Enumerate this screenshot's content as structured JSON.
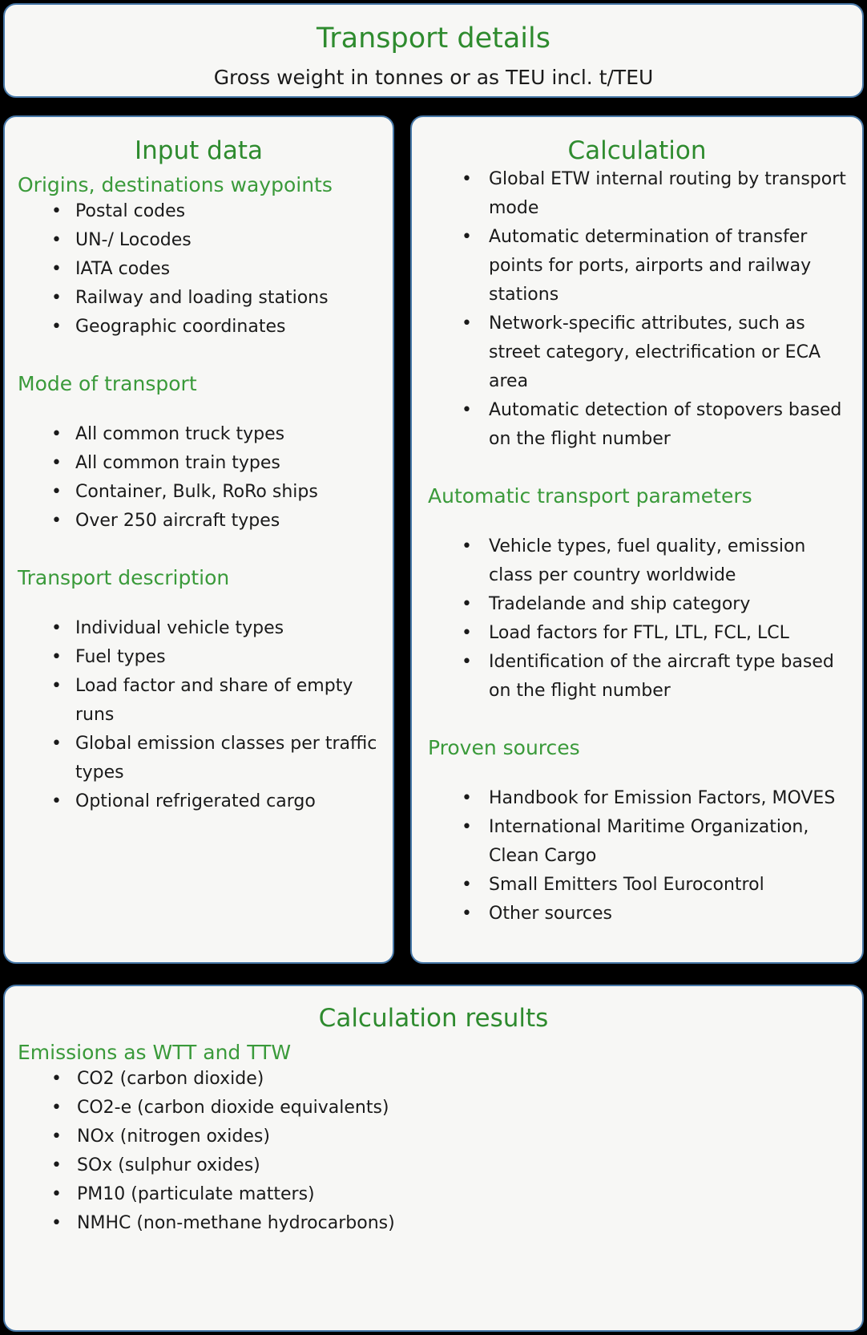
{
  "header": {
    "title": "Transport details",
    "subtitle": "Gross weight in tonnes or as TEU incl. t/TEU"
  },
  "input_card": {
    "title": "Input data",
    "sections": [
      {
        "heading": "Origins, destinations waypoints",
        "items": [
          "Postal codes",
          "UN-/ Locodes",
          "IATA codes",
          "Railway and loading stations",
          "Geographic coordinates"
        ]
      },
      {
        "heading": "Mode of transport",
        "items": [
          "All common truck types",
          "All common train types",
          "Container, Bulk, RoRo ships",
          "Over 250 aircraft types"
        ]
      },
      {
        "heading": "Transport description",
        "items": [
          "Individual vehicle types",
          "Fuel types",
          "Load factor and share of empty runs",
          "Global emission classes per traffic types",
          "Optional refrigerated cargo"
        ]
      }
    ]
  },
  "calculation_card": {
    "title": "Calculation",
    "intro_items": [
      "Global ETW internal routing by transport mode",
      "Automatic determination of transfer points for ports, airports and railway stations",
      "Network-specific attributes, such as street category, electrification or ECA area",
      "Automatic detection of stopovers based on the flight number"
    ],
    "sections": [
      {
        "heading": "Automatic transport parameters",
        "items": [
          "Vehicle types, fuel quality, emission class per country worldwide",
          "Tradelande and ship category",
          "Load factors for FTL, LTL, FCL, LCL",
          "Identification of the aircraft type based on the flight number"
        ]
      },
      {
        "heading": "Proven sources",
        "items": [
          "Handbook for Emission Factors, MOVES",
          "International Maritime Organization, Clean Cargo",
          "Small Emitters Tool Eurocontrol",
          "Other sources"
        ]
      }
    ]
  },
  "results_card": {
    "title": "Calculation results",
    "sections": [
      {
        "heading": "Emissions as WTT and TTW",
        "items": [
          "CO2 (carbon dioxide)",
          "CO2-e (carbon dioxide equivalents)",
          "NOx (nitrogen oxides)",
          "SOx (sulphur oxides)",
          "PM10 (particulate matters)",
          "NMHC (non-methane hydrocarbons)"
        ]
      }
    ]
  },
  "colors": {
    "accent_green": "#2e8b2e",
    "section_green": "#3a9a3a",
    "card_border_blue": "#4778a8",
    "card_background": "#f7f7f5",
    "page_background": "#000000",
    "body_text": "#1a1a1a"
  }
}
